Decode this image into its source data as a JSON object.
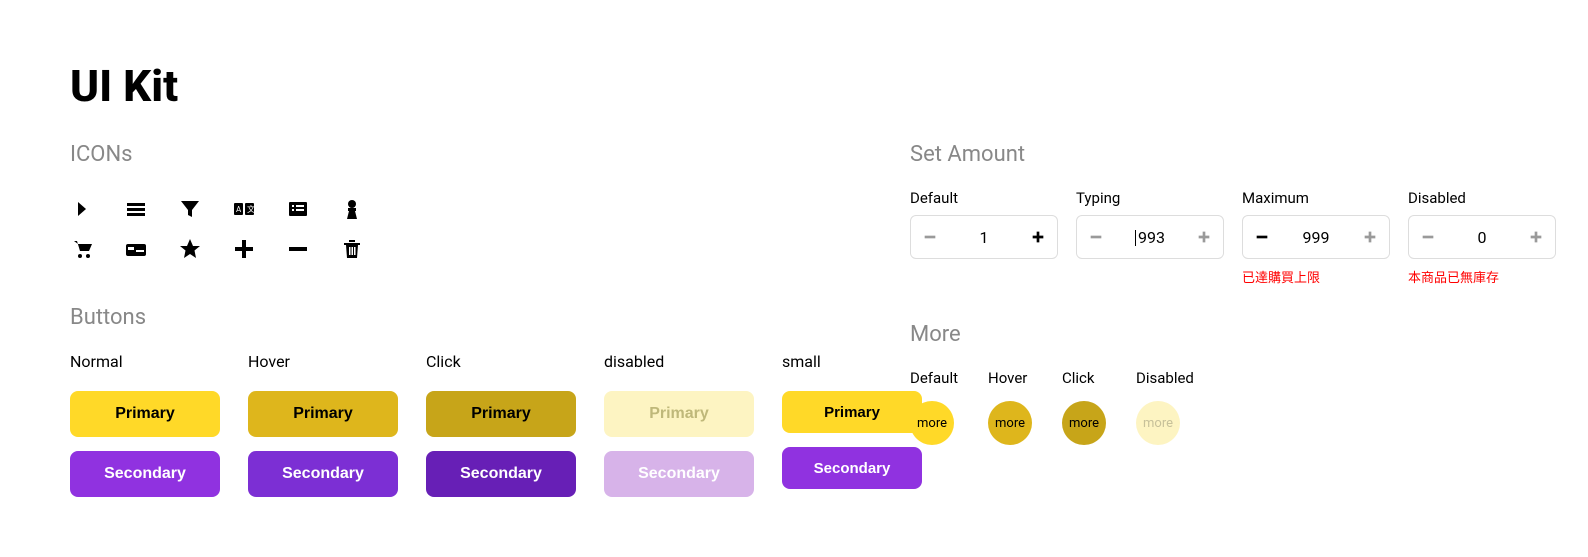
{
  "title": "UI Kit",
  "sections": {
    "icons_title": "ICONs",
    "buttons_title": "Buttons",
    "set_amount_title": "Set Amount",
    "more_title": "More"
  },
  "button_states": {
    "normal": "Normal",
    "hover": "Hover",
    "click": "Click",
    "disabled": "disabled",
    "small": "small"
  },
  "button_labels": {
    "primary": "Primary",
    "secondary": "Secondary"
  },
  "set_amount": {
    "default": {
      "label": "Default",
      "value": "1"
    },
    "typing": {
      "label": "Typing",
      "value": "993"
    },
    "maximum": {
      "label": "Maximum",
      "value": "999",
      "error": "已達購買上限"
    },
    "disabled": {
      "label": "Disabled",
      "value": "0",
      "error": "本商品已無庫存"
    }
  },
  "more": {
    "default": {
      "label": "Default",
      "text": "more"
    },
    "hover": {
      "label": "Hover",
      "text": "more"
    },
    "click": {
      "label": "Click",
      "text": "more"
    },
    "disabled": {
      "label": "Disabled",
      "text": "more"
    }
  }
}
